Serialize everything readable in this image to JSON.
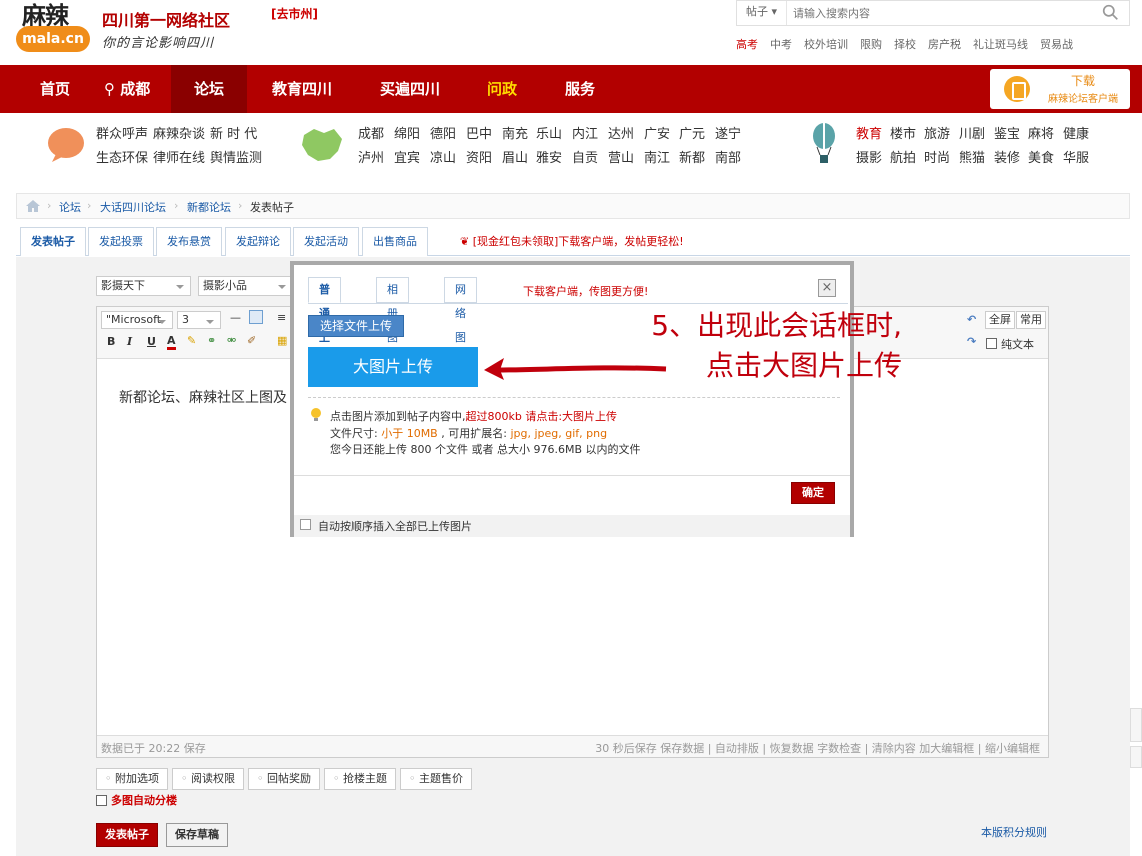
{
  "header": {
    "logo_word": "麻辣",
    "logo_badge": "mala.cn",
    "brand": "四川第一网络社区",
    "slogan": "你的言论影响四川",
    "city_link": "[去市州]",
    "search_type": "帖子",
    "search_placeholder": "请输入搜索内容",
    "hot_links": [
      "高考",
      "中考",
      "校外培训",
      "限购",
      "择校",
      "房产税",
      "礼让斑马线",
      "贸易战"
    ]
  },
  "nav": {
    "items": [
      "首页",
      "成都",
      "论坛",
      "教育四川",
      "买遍四川",
      "问政",
      "服务"
    ],
    "download_title": "下载",
    "download_sub": "麻辣论坛客户端"
  },
  "quick": {
    "left": [
      "群众呼声",
      "麻辣杂谈",
      "新 时 代",
      "生态环保",
      "律师在线",
      "舆情监测"
    ],
    "cities_row1": [
      "成都",
      "绵阳",
      "德阳",
      "巴中",
      "南充",
      "乐山",
      "内江",
      "达州",
      "广安",
      "广元",
      "遂宁"
    ],
    "cities_row2": [
      "泸州",
      "宜宾",
      "凉山",
      "资阳",
      "眉山",
      "雅安",
      "自贡",
      "营山",
      "南江",
      "新都",
      "南部"
    ],
    "topics_row1": [
      "教育",
      "楼市",
      "旅游",
      "川剧",
      "鉴宝",
      "麻将",
      "健康"
    ],
    "topics_row2": [
      "摄影",
      "航拍",
      "时尚",
      "熊猫",
      "装修",
      "美食",
      "华服"
    ]
  },
  "breadcrumb": [
    "论坛",
    "大话四川论坛",
    "新都论坛",
    "发表帖子"
  ],
  "post_tabs": [
    "发表帖子",
    "发起投票",
    "发布悬赏",
    "发起辩论",
    "发起活动",
    "出售商品"
  ],
  "promo": "[现金红包未领取]下载客户端，发帖更轻松!",
  "editor": {
    "category1": "影摄天下",
    "category2": "摄影小品",
    "font": "\"Microsoft",
    "size": "3",
    "content": "新都论坛、麻辣社区上图及",
    "fullscreen": "全屏",
    "common": "常用",
    "plaintext": "纯文本",
    "saved": "数据已于 20:22 保存",
    "status_right": "30 秒后保存 保存数据 | 自动排版 | 恢复数据  字数检查 | 清除内容  加大编辑框 | 缩小编辑框"
  },
  "options": [
    "附加选项",
    "阅读权限",
    "回帖奖励",
    "抢楼主题",
    "主题售价"
  ],
  "multi_floor": "多图自动分楼",
  "footer": {
    "post_button": "发表帖子",
    "draft_button": "保存草稿",
    "rules": "本版积分规则"
  },
  "dialog": {
    "tabs": [
      "普通上传",
      "相册图片",
      "网络图片"
    ],
    "tab_promo": "下载客户端，传图更方便!",
    "close": "×",
    "select_file": "选择文件上传",
    "big_upload": "大图片上传",
    "tip1_a": "点击图片添加到帖子内容中,",
    "tip1_b": "超过800kb 请点击:大图片上传",
    "tip2_a": "文件尺寸: ",
    "tip2_b": "小于 10MB",
    "tip2_c": " , 可用扩展名: ",
    "tip2_d": "jpg, jpeg, gif, png",
    "tip3": "您今日还能上传 800 个文件 或者 总大小 976.6MB 以内的文件",
    "confirm": "确定",
    "auto_insert": "自动按顺序插入全部已上传图片"
  },
  "annotation": {
    "line1": "5、出现此会话框时,",
    "line2": "点击大图片上传"
  }
}
